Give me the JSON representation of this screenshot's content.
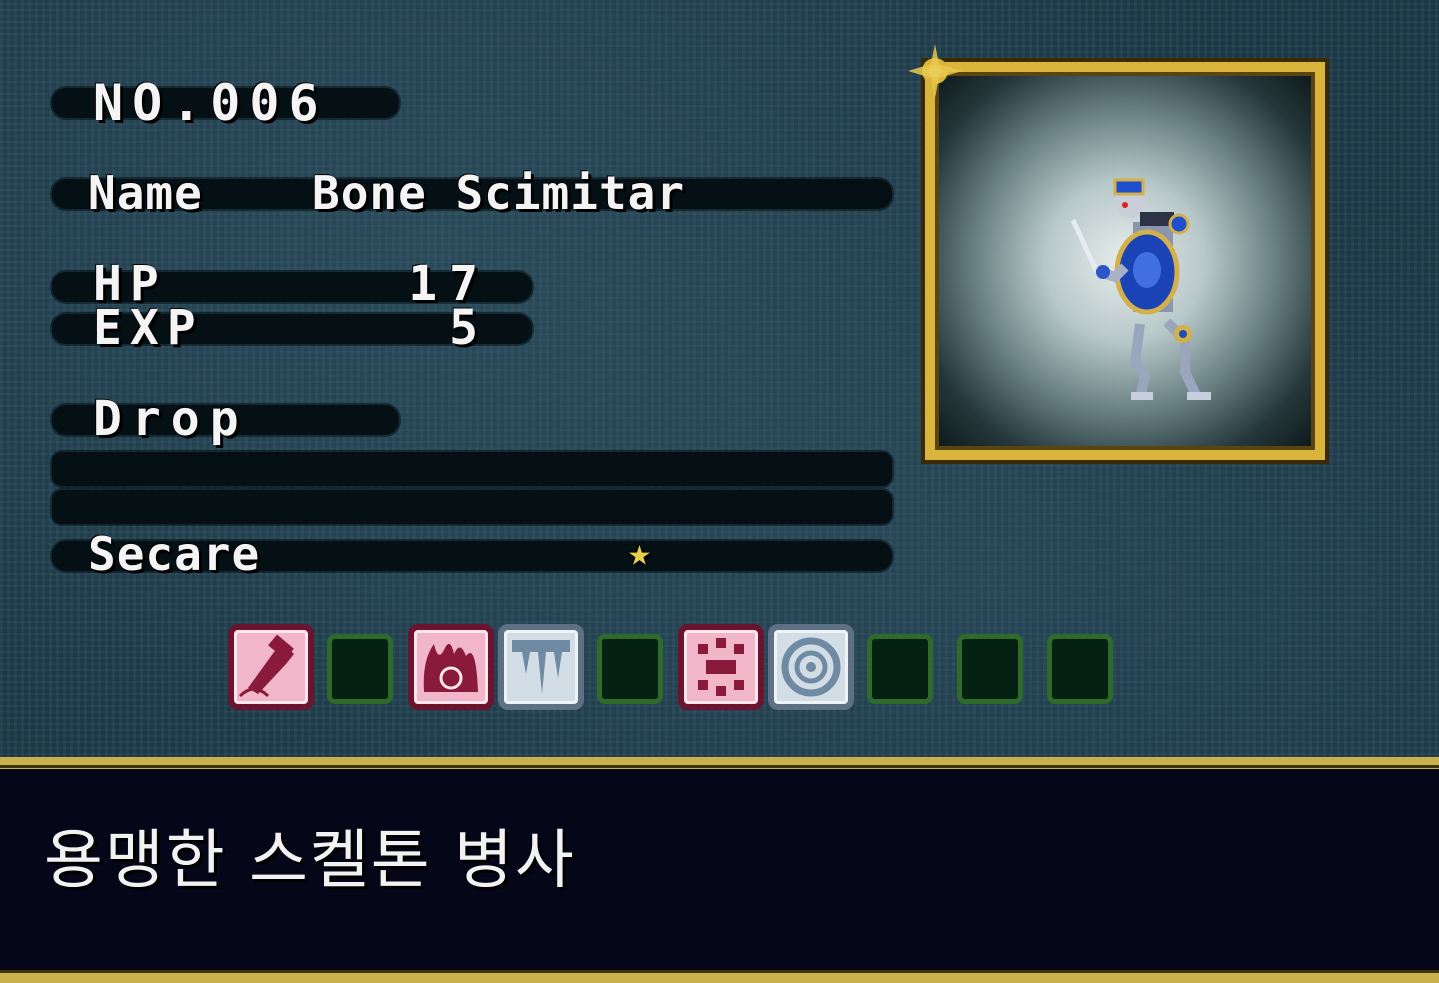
{
  "entry": {
    "number_label": "NO.006",
    "name_label": "Name",
    "name_value": "Bone Scimitar",
    "hp_label": "HP",
    "hp_value": "17",
    "exp_label": "EXP",
    "exp_value": "5",
    "drop_label": "Drop",
    "drop_items": [
      "",
      ""
    ],
    "secare_label": "Secare",
    "secare_mark": "★"
  },
  "portrait": {
    "subject": "Bone Scimitar skeleton soldier",
    "frame_color": "#d9b53c"
  },
  "resistances": [
    {
      "icon": "strike-element-icon",
      "state": "active"
    },
    {
      "icon": "empty-slot",
      "state": "empty"
    },
    {
      "icon": "fire-element-icon",
      "state": "active"
    },
    {
      "icon": "ice-element-icon",
      "state": "active"
    },
    {
      "icon": "empty-slot",
      "state": "empty"
    },
    {
      "icon": "dark-element-icon",
      "state": "active"
    },
    {
      "icon": "wind-element-icon",
      "state": "active"
    },
    {
      "icon": "empty-slot",
      "state": "empty"
    },
    {
      "icon": "empty-slot",
      "state": "empty"
    },
    {
      "icon": "empty-slot",
      "state": "empty"
    }
  ],
  "description": "용맹한 스켈톤 병사",
  "colors": {
    "background": "#1d3b4a",
    "gold_trim": "#c9b04a",
    "panel": "#050718",
    "pink_icon": "#f1b6c9",
    "pale_icon": "#d3dde5",
    "empty_slot_border": "#2e6a2a"
  }
}
